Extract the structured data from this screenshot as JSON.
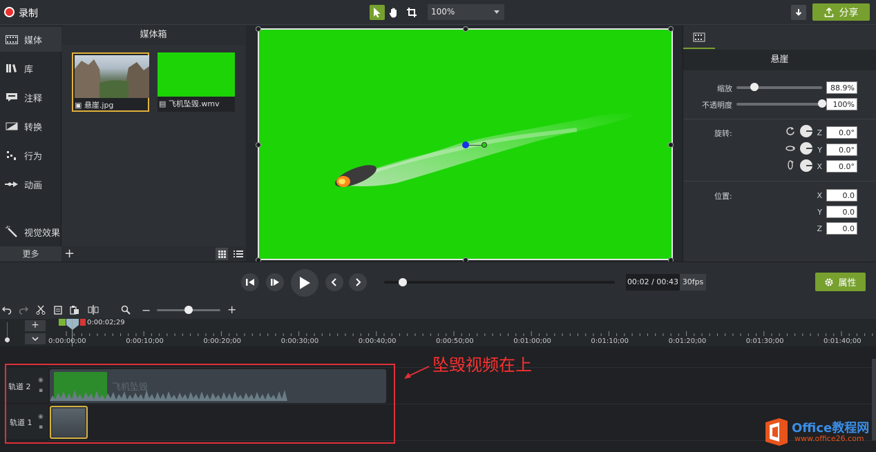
{
  "topbar": {
    "record_label": "录制",
    "zoom_value": "100%",
    "share_label": "分享"
  },
  "sidenav": {
    "items": [
      {
        "label": "媒体"
      },
      {
        "label": "库"
      },
      {
        "label": "注释"
      },
      {
        "label": "转换"
      },
      {
        "label": "行为"
      },
      {
        "label": "动画"
      },
      {
        "label": "视觉效果"
      }
    ],
    "more_label": "更多"
  },
  "media_bin": {
    "title": "媒体箱",
    "items": [
      {
        "name": "悬崖.jpg"
      },
      {
        "name": "飞机坠毁.wmv"
      }
    ]
  },
  "properties": {
    "title": "悬崖",
    "scale_label": "缩放",
    "scale_value": "88.9%",
    "scale_fraction": 0.21,
    "opacity_label": "不透明度",
    "opacity_value": "100%",
    "opacity_fraction": 1.0,
    "rotation_label": "旋转:",
    "rotation": [
      {
        "axis": "Z",
        "value": "0.0°"
      },
      {
        "axis": "Y",
        "value": "0.0°"
      },
      {
        "axis": "X",
        "value": "0.0°"
      }
    ],
    "position_label": "位置:",
    "position": [
      {
        "axis": "X",
        "value": "0.0"
      },
      {
        "axis": "Y",
        "value": "0.0"
      },
      {
        "axis": "Z",
        "value": "0.0"
      }
    ]
  },
  "transport": {
    "time": "00:02 / 00:43",
    "fps": "30fps",
    "progress_fraction": 0.08,
    "properties_label": "属性"
  },
  "timeline": {
    "playhead_time": "0:00:02;29",
    "ruler_labels": [
      "0:00:00;00",
      "0:00:10;00",
      "0:00:20;00",
      "0:00:30;00",
      "0:00:40;00",
      "0:00:50;00",
      "0:01:00;00",
      "0:01:10;00",
      "0:01:20;00",
      "0:01:30;00",
      "0:01:40;00"
    ],
    "tracks": [
      {
        "label": "轨道 2",
        "clip": "飞机坠毁"
      },
      {
        "label": "轨道 1",
        "clip": ""
      }
    ],
    "annotation": "坠毁视频在上"
  },
  "watermark": {
    "brand": "Office教程网",
    "url": "www.office26.com"
  },
  "colors": {
    "accent": "#77a02f",
    "record": "#ec2f2f",
    "green_screen": "#1dd407",
    "annotation": "#e0303a"
  }
}
